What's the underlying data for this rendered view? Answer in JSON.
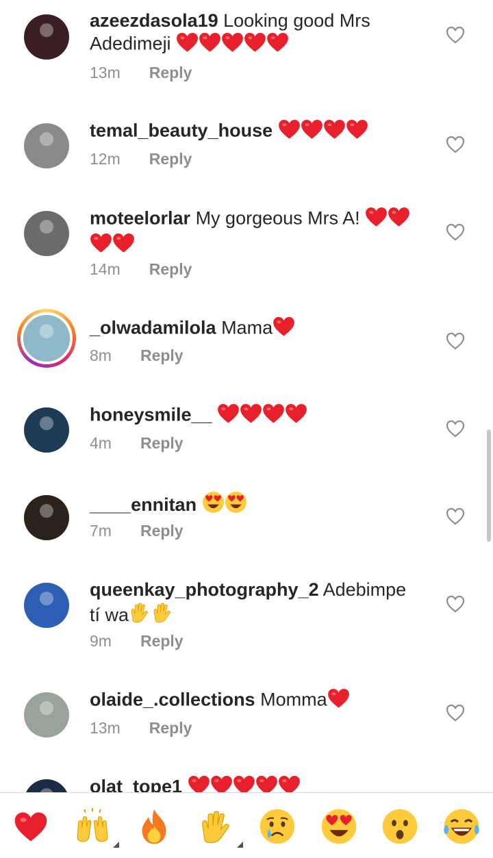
{
  "comments": [
    {
      "username": "azeezdasola19",
      "text": " Looking good Mrs Adedimeji ",
      "emoji": "❤❤❤❤❤",
      "time": "13m",
      "reply": "Reply",
      "avatar_color": "#3a1e22"
    },
    {
      "username": "temal_beauty_house",
      "text": " ",
      "emoji": "❤❤❤❤",
      "time": "12m",
      "reply": "Reply",
      "avatar_color": "#8a8a8a"
    },
    {
      "username": "moteelorlar",
      "text": " My gorgeous Mrs A! ",
      "emoji": "❤❤❤❤",
      "time": "14m",
      "reply": "Reply",
      "avatar_color": "#6b6b6b"
    },
    {
      "username": "_olwadamilola",
      "text": " Mama",
      "emoji": "❤",
      "time": "8m",
      "reply": "Reply",
      "avatar_color": "#8fb8c9"
    },
    {
      "username": "honeysmile__",
      "text": " ",
      "emoji": "❤❤❤❤",
      "time": "4m",
      "reply": "Reply",
      "avatar_color": "#1d3a56"
    },
    {
      "username": "____ennitan",
      "text": " ",
      "emoji": "😍😍",
      "time": "7m",
      "reply": "Reply",
      "avatar_color": "#2b221c"
    },
    {
      "username": "queenkay_photography_2",
      "text": " Adebimpe tí wa",
      "emoji": "🙌🙌",
      "time": "9m",
      "reply": "Reply",
      "avatar_color": "#2c5fb3"
    },
    {
      "username": "olaide_.collections",
      "text": " Momma",
      "emoji": "❤",
      "time": "13m",
      "reply": "Reply",
      "avatar_color": "#9aa39a"
    },
    {
      "username": "olat_tope1",
      "text": " ",
      "emoji": "❤❤❤❤❤",
      "time": "",
      "reply": "",
      "avatar_color": "#1c2a44"
    }
  ],
  "reactions": [
    "heart",
    "raised-hands",
    "fire",
    "clapping-hands",
    "crying-face",
    "heart-eyes",
    "surprised-face",
    "laughing-face"
  ],
  "colors": {
    "accent_red": "#e8202c",
    "text": "#262626",
    "muted": "#8e8e8e",
    "emoji_yellow": "#ffcb3d"
  }
}
